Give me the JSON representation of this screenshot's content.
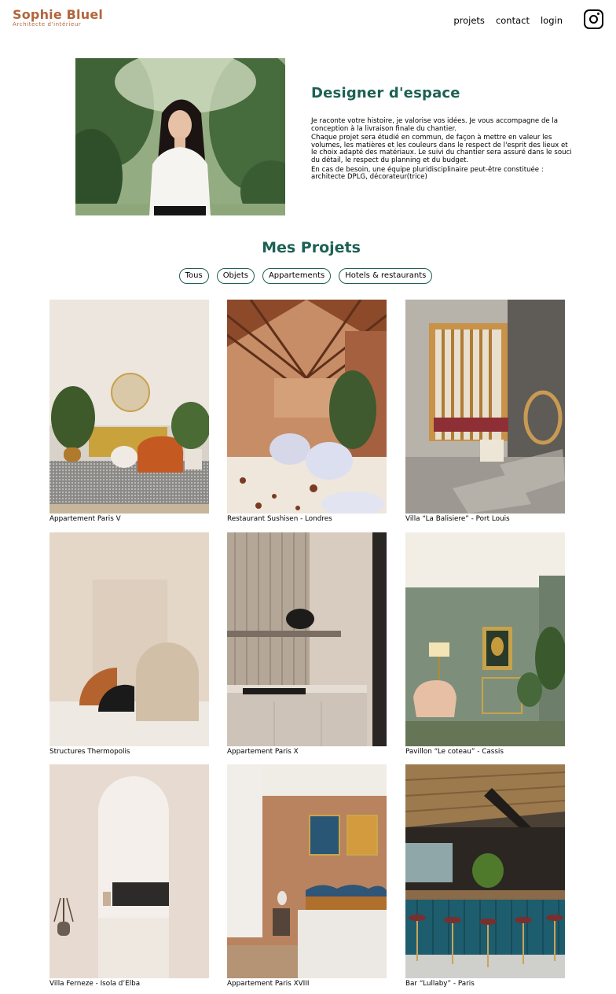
{
  "header": {
    "brand_name": "Sophie Bluel",
    "brand_subtitle": "Architecte d'intérieur",
    "nav": [
      {
        "label": "projets"
      },
      {
        "label": "contact"
      },
      {
        "label": "login"
      }
    ],
    "social_icon": "instagram-icon"
  },
  "intro": {
    "title": "Designer d'espace",
    "paragraphs": [
      "Je raconte votre histoire, je valorise vos idées. Je vous accompagne de la conception à la livraison finale du chantier.",
      "Chaque projet sera étudié en commun, de façon à mettre en valeur les volumes, les matières et les couleurs dans le respect de l'esprit des lieux et le choix adapté des matériaux. Le suivi du chantier sera assuré dans le souci du détail, le respect du planning et du budget.",
      "En cas de besoin, une équipe pluridisciplinaire peut-être constituée : architecte DPLG, décorateur(trice)"
    ]
  },
  "projects": {
    "title": "Mes Projets",
    "filters": [
      "Tous",
      "Objets",
      "Appartements",
      "Hotels & restaurants"
    ],
    "items": [
      {
        "caption": "Appartement Paris V"
      },
      {
        "caption": "Restaurant Sushisen - Londres"
      },
      {
        "caption": "Villa “La Balisiere” - Port Louis"
      },
      {
        "caption": "Structures Thermopolis"
      },
      {
        "caption": "Appartement Paris X"
      },
      {
        "caption": "Pavillon “Le coteau” - Cassis"
      },
      {
        "caption": "Villa Ferneze - Isola d’Elba"
      },
      {
        "caption": "Appartement Paris XVIII"
      },
      {
        "caption": "Bar “Lullaby” - Paris"
      }
    ]
  },
  "colors": {
    "brand": "#B1663C",
    "accent": "#1D6154"
  }
}
